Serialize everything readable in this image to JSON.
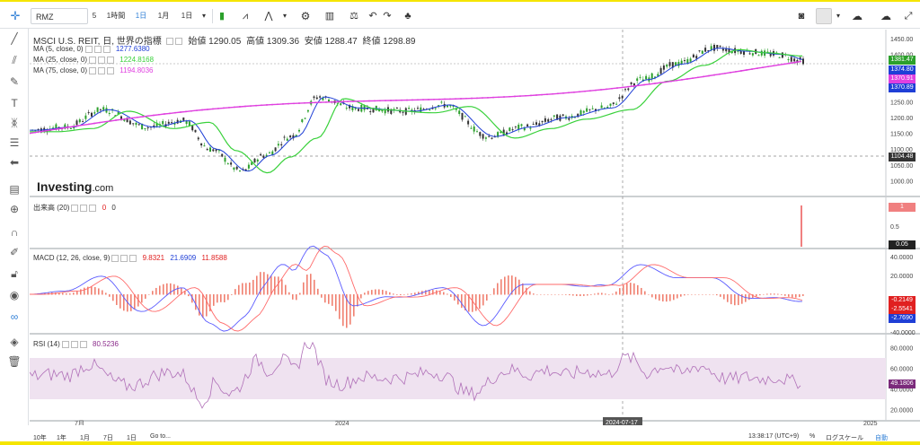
{
  "toolbar": {
    "symbol": "RMZ",
    "interval_count": "5",
    "interval_1h": "1時間",
    "interval_1d": "1日",
    "interval_1m": "1月",
    "interval_1d_dropdown": "1日"
  },
  "main_pane": {
    "title": "MSCI U.S. REIT, 日, 世界の指標",
    "ohlc": {
      "open_label": "始値",
      "open": "1290.05",
      "high_label": "高値",
      "high": "1309.36",
      "low_label": "安値",
      "low": "1288.47",
      "close_label": "終値",
      "close": "1298.89"
    },
    "ma5": {
      "label": "MA (5, close, 0)",
      "value": "1277.6380"
    },
    "ma25": {
      "label": "MA (25, close, 0)",
      "value": "1224.8168"
    },
    "ma75": {
      "label": "MA (75, close, 0)",
      "value": "1194.8036"
    },
    "watermark": "Investing",
    "watermark_suffix": ".com",
    "y_ticks": [
      "1450.00",
      "1400.00",
      "1350.00",
      "1300.00",
      "1250.00",
      "1200.00",
      "1150.00",
      "1100.00",
      "1050.00",
      "1000.00"
    ],
    "badges": [
      {
        "text": "1381.47",
        "color": "#2ca02c"
      },
      {
        "text": "1374.80",
        "color": "#1f3fd6"
      },
      {
        "text": "1370.91",
        "color": "#e040e0"
      },
      {
        "text": "1370.89",
        "color": "#1f3fd6"
      },
      {
        "text": "1104.48",
        "color": "#333333"
      }
    ]
  },
  "volume_pane": {
    "label": "出来高 (20)",
    "v1": "0",
    "v2": "0",
    "y_ticks": [
      "1",
      "0.5"
    ],
    "badge": "0.05"
  },
  "macd_pane": {
    "label": "MACD (12, 26, close, 9)",
    "v1": "9.8321",
    "v2": "21.6909",
    "v3": "11.8588",
    "y_ticks": [
      "40.0000",
      "20.0000",
      "-20.0000",
      "-40.0000"
    ],
    "badges": [
      {
        "text": "-0.2149",
        "color": "#e02020"
      },
      {
        "text": "-2.5541",
        "color": "#e02020"
      },
      {
        "text": "-2.7690",
        "color": "#1f3fd6"
      }
    ]
  },
  "rsi_pane": {
    "label": "RSI (14)",
    "value": "80.5236",
    "y_ticks": [
      "80.0000",
      "60.0000",
      "40.0000",
      "20.0000"
    ],
    "badge": "49.1806"
  },
  "x_axis": {
    "labels": [
      "7月",
      "2024",
      "2025"
    ],
    "crosshair": "2024-07-17"
  },
  "bottom": {
    "ranges": [
      "10年",
      "1年",
      "1月",
      "7日",
      "1日",
      "Go to..."
    ],
    "time": "13:38:17 (UTC+9)",
    "percent": "%",
    "log": "ログスケール",
    "auto": "自動"
  },
  "colors": {
    "candle_up": "#2ca02c",
    "candle_down": "#333333",
    "ma5": "#1f3fd6",
    "ma25": "#39d13b",
    "ma75": "#e040e0",
    "rsi_fill": "#efe2f0",
    "macd_hist": "#f08070"
  }
}
